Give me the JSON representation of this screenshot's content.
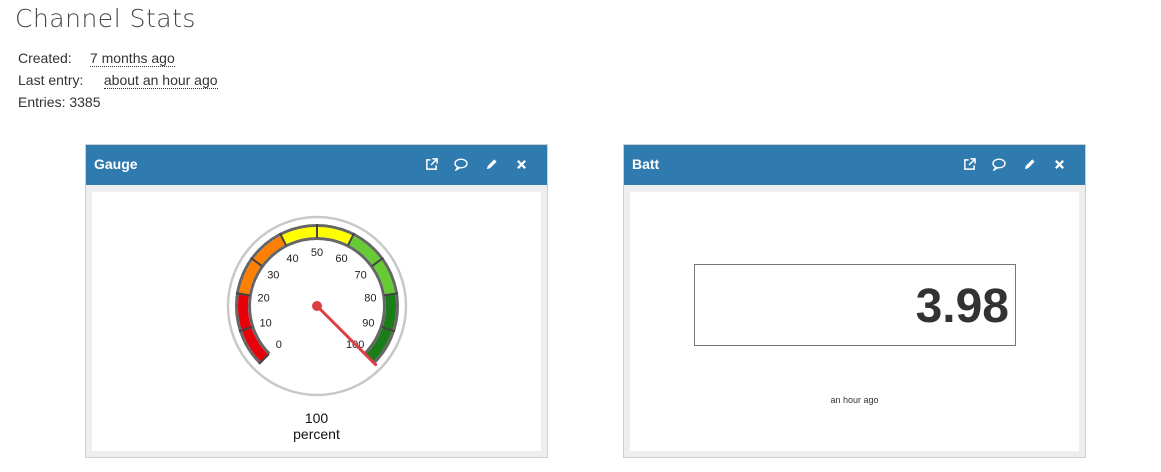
{
  "page": {
    "title": "Channel Stats"
  },
  "stats": {
    "created_label": "Created:",
    "created_value": "7 months ago",
    "last_entry_label": "Last entry:",
    "last_entry_value": "about an hour ago",
    "entries_text": "Entries: 3385"
  },
  "widgets": [
    {
      "title": "Gauge",
      "icons": [
        "external-link-icon",
        "comment-icon",
        "pencil-icon",
        "close-icon"
      ],
      "gauge": {
        "value": 100,
        "value_text": "100",
        "units": "percent",
        "min": 0,
        "max": 100,
        "ticks": [
          "0",
          "10",
          "20",
          "30",
          "40",
          "50",
          "60",
          "70",
          "80",
          "90",
          "100"
        ],
        "bands": [
          {
            "from": 0,
            "to": 20,
            "color": "#e8000b"
          },
          {
            "from": 20,
            "to": 40,
            "color": "#ff7f00"
          },
          {
            "from": 40,
            "to": 60,
            "color": "#ffff00"
          },
          {
            "from": 60,
            "to": 80,
            "color": "#66cc33"
          },
          {
            "from": 80,
            "to": 100,
            "color": "#1a7d1a"
          }
        ],
        "needle_color": "#dd3e43"
      }
    },
    {
      "title": "Batt",
      "icons": [
        "external-link-icon",
        "comment-icon",
        "pencil-icon",
        "close-icon"
      ],
      "value": "3.98",
      "timestamp": "an hour ago"
    }
  ]
}
